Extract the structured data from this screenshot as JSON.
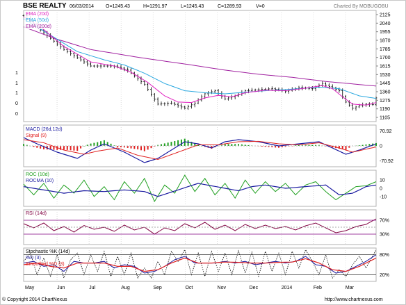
{
  "header": {
    "title": "BSE REALTY",
    "date": "06/03/2014",
    "open": "O=1245.43",
    "high": "H=1291.97",
    "low": "L=1245.43",
    "close": "C=1289.93",
    "volume": "V=0",
    "charted_by": "Charted By MOBUGOBU"
  },
  "footer": {
    "copyright": "© Copyright 2014 ChartNexus",
    "url": "http://www.chartnexus.com"
  },
  "colors": {
    "price": "#111111",
    "ema20": "#e020c0",
    "ema50": "#2aa8e0",
    "ema200": "#a020a0",
    "macd": "#1a1aa0",
    "signal": "#e02020",
    "hist_up": "#20a020",
    "hist_down": "#e02020",
    "roc": "#20a020",
    "rocma": "#1a1aa0",
    "rsi": "#800040",
    "stoch_k": "#000000",
    "stoch_d": "#1a1aa0",
    "stoch_sd": "#e02020",
    "frame": "#800080"
  },
  "chart_data": [
    {
      "type": "line",
      "panel": "price",
      "legend": [
        "EMA (20d)",
        "EMA (50d)",
        "EMA (200d)"
      ],
      "y_ticks_right": [
        "2125",
        "2040",
        "1955",
        "1870",
        "1785",
        "1700",
        "1615",
        "1530",
        "1445",
        "1360",
        "1275",
        "1190",
        "1105"
      ],
      "y_ticks_left": [
        "1",
        "1",
        "1",
        "0",
        "0"
      ],
      "ylim": [
        1060,
        2140
      ],
      "x_months": [
        "May",
        "Jun",
        "Jul",
        "Aug",
        "Sep",
        "Oct",
        "Nov",
        "Dec",
        "2014",
        "Feb",
        "Mar"
      ],
      "price_keypoints": [
        [
          0,
          2090
        ],
        [
          5,
          1950
        ],
        [
          12,
          1760
        ],
        [
          20,
          1600
        ],
        [
          27,
          1600
        ],
        [
          31,
          1560
        ],
        [
          36,
          1420
        ],
        [
          40,
          1230
        ],
        [
          44,
          1240
        ],
        [
          48,
          1190
        ],
        [
          51,
          1240
        ],
        [
          54,
          1330
        ],
        [
          57,
          1360
        ],
        [
          60,
          1280
        ],
        [
          63,
          1310
        ],
        [
          66,
          1360
        ],
        [
          70,
          1370
        ],
        [
          74,
          1380
        ],
        [
          78,
          1355
        ],
        [
          82,
          1390
        ],
        [
          86,
          1380
        ],
        [
          89,
          1430
        ],
        [
          91,
          1400
        ],
        [
          94,
          1360
        ],
        [
          96,
          1250
        ],
        [
          98,
          1190
        ],
        [
          100,
          1215
        ],
        [
          102,
          1230
        ],
        [
          104,
          1225
        ],
        [
          105,
          1290
        ]
      ],
      "ema20_keypoints": [
        [
          0,
          2080
        ],
        [
          5,
          1980
        ],
        [
          12,
          1790
        ],
        [
          20,
          1640
        ],
        [
          27,
          1600
        ],
        [
          32,
          1540
        ],
        [
          37,
          1440
        ],
        [
          42,
          1310
        ],
        [
          46,
          1250
        ],
        [
          50,
          1245
        ],
        [
          54,
          1290
        ],
        [
          58,
          1315
        ],
        [
          62,
          1300
        ],
        [
          66,
          1340
        ],
        [
          72,
          1365
        ],
        [
          78,
          1360
        ],
        [
          84,
          1385
        ],
        [
          89,
          1410
        ],
        [
          92,
          1380
        ],
        [
          95,
          1300
        ],
        [
          98,
          1230
        ],
        [
          102,
          1220
        ],
        [
          105,
          1245
        ]
      ],
      "ema50_keypoints": [
        [
          0,
          2060
        ],
        [
          8,
          1900
        ],
        [
          16,
          1740
        ],
        [
          24,
          1660
        ],
        [
          30,
          1610
        ],
        [
          36,
          1530
        ],
        [
          42,
          1430
        ],
        [
          48,
          1360
        ],
        [
          54,
          1340
        ],
        [
          60,
          1330
        ],
        [
          66,
          1345
        ],
        [
          72,
          1360
        ],
        [
          80,
          1375
        ],
        [
          88,
          1395
        ],
        [
          94,
          1380
        ],
        [
          100,
          1310
        ],
        [
          105,
          1285
        ]
      ],
      "ema200_keypoints": [
        [
          0,
          1980
        ],
        [
          10,
          1860
        ],
        [
          20,
          1760
        ],
        [
          35,
          1680
        ],
        [
          50,
          1610
        ],
        [
          60,
          1560
        ],
        [
          70,
          1520
        ],
        [
          80,
          1490
        ],
        [
          90,
          1450
        ],
        [
          100,
          1420
        ],
        [
          105,
          1405
        ]
      ]
    },
    {
      "type": "line",
      "panel": "macd",
      "legend": [
        "MACD (26d,12d)",
        "Signal (9)"
      ],
      "y_ticks": [
        "70.92",
        "0",
        "-70.92"
      ],
      "ylim": [
        -100,
        100
      ],
      "macd_keypoints": [
        [
          0,
          40
        ],
        [
          4,
          10
        ],
        [
          10,
          -30
        ],
        [
          16,
          -60
        ],
        [
          20,
          -20
        ],
        [
          24,
          10
        ],
        [
          30,
          -30
        ],
        [
          36,
          -80
        ],
        [
          40,
          -60
        ],
        [
          44,
          -20
        ],
        [
          48,
          20
        ],
        [
          52,
          10
        ],
        [
          56,
          -10
        ],
        [
          60,
          20
        ],
        [
          64,
          30
        ],
        [
          70,
          20
        ],
        [
          76,
          0
        ],
        [
          82,
          10
        ],
        [
          88,
          20
        ],
        [
          92,
          -10
        ],
        [
          96,
          -40
        ],
        [
          100,
          -20
        ],
        [
          105,
          10
        ]
      ],
      "signal_keypoints": [
        [
          0,
          30
        ],
        [
          6,
          15
        ],
        [
          12,
          -20
        ],
        [
          18,
          -40
        ],
        [
          22,
          -25
        ],
        [
          28,
          -10
        ],
        [
          34,
          -45
        ],
        [
          40,
          -65
        ],
        [
          46,
          -30
        ],
        [
          52,
          5
        ],
        [
          58,
          5
        ],
        [
          64,
          20
        ],
        [
          70,
          22
        ],
        [
          76,
          10
        ],
        [
          82,
          5
        ],
        [
          88,
          15
        ],
        [
          94,
          -10
        ],
        [
          98,
          -30
        ],
        [
          105,
          -5
        ]
      ]
    },
    {
      "type": "line",
      "panel": "roc",
      "legend": [
        "ROC (10d)",
        "ROCMA (10)"
      ],
      "y_ticks": [
        "10",
        "0",
        "-10"
      ],
      "ylim": [
        -22,
        22
      ],
      "roc_keypoints": [
        [
          0,
          5
        ],
        [
          3,
          -8
        ],
        [
          6,
          6
        ],
        [
          9,
          -12
        ],
        [
          12,
          4
        ],
        [
          15,
          -6
        ],
        [
          18,
          10
        ],
        [
          21,
          -10
        ],
        [
          24,
          2
        ],
        [
          27,
          -14
        ],
        [
          30,
          8
        ],
        [
          33,
          -6
        ],
        [
          36,
          12
        ],
        [
          39,
          -16
        ],
        [
          42,
          4
        ],
        [
          45,
          -6
        ],
        [
          48,
          16
        ],
        [
          51,
          -4
        ],
        [
          54,
          12
        ],
        [
          57,
          -8
        ],
        [
          60,
          6
        ],
        [
          63,
          -12
        ],
        [
          66,
          10
        ],
        [
          69,
          -6
        ],
        [
          72,
          8
        ],
        [
          75,
          -4
        ],
        [
          78,
          6
        ],
        [
          81,
          -8
        ],
        [
          84,
          4
        ],
        [
          87,
          8
        ],
        [
          90,
          -4
        ],
        [
          93,
          -14
        ],
        [
          96,
          -6
        ],
        [
          99,
          2
        ],
        [
          102,
          3
        ],
        [
          105,
          8
        ]
      ],
      "rocma_keypoints": [
        [
          0,
          2
        ],
        [
          6,
          -2
        ],
        [
          12,
          -6
        ],
        [
          18,
          -3
        ],
        [
          24,
          -4
        ],
        [
          30,
          -2
        ],
        [
          36,
          -4
        ],
        [
          40,
          -10
        ],
        [
          46,
          -2
        ],
        [
          52,
          6
        ],
        [
          56,
          3
        ],
        [
          60,
          0
        ],
        [
          64,
          -3
        ],
        [
          68,
          2
        ],
        [
          72,
          4
        ],
        [
          78,
          0
        ],
        [
          84,
          2
        ],
        [
          90,
          4
        ],
        [
          94,
          -8
        ],
        [
          98,
          -6
        ],
        [
          102,
          2
        ],
        [
          105,
          4
        ]
      ]
    },
    {
      "type": "line",
      "panel": "rsi",
      "legend": [
        "RSI (14d)"
      ],
      "y_ticks": [
        "70%",
        "30%"
      ],
      "ylim": [
        0,
        100
      ],
      "rsi_keypoints": [
        [
          0,
          60
        ],
        [
          3,
          48
        ],
        [
          6,
          62
        ],
        [
          9,
          40
        ],
        [
          12,
          52
        ],
        [
          15,
          36
        ],
        [
          18,
          55
        ],
        [
          21,
          44
        ],
        [
          24,
          50
        ],
        [
          27,
          38
        ],
        [
          30,
          56
        ],
        [
          33,
          42
        ],
        [
          36,
          50
        ],
        [
          39,
          30
        ],
        [
          42,
          48
        ],
        [
          45,
          40
        ],
        [
          48,
          60
        ],
        [
          51,
          48
        ],
        [
          54,
          64
        ],
        [
          57,
          44
        ],
        [
          60,
          56
        ],
        [
          63,
          40
        ],
        [
          66,
          58
        ],
        [
          69,
          46
        ],
        [
          72,
          56
        ],
        [
          75,
          46
        ],
        [
          78,
          52
        ],
        [
          81,
          42
        ],
        [
          84,
          54
        ],
        [
          87,
          62
        ],
        [
          90,
          48
        ],
        [
          93,
          34
        ],
        [
          96,
          40
        ],
        [
          99,
          52
        ],
        [
          102,
          58
        ],
        [
          105,
          74
        ]
      ]
    },
    {
      "type": "line",
      "panel": "stochastic",
      "legend": [
        "Stochastic %K (14d)",
        "%D (3)",
        "Smoothed %D (3)"
      ],
      "y_ticks": [
        "80%",
        "20%"
      ],
      "ylim": [
        0,
        100
      ],
      "k_keypoints": [
        [
          0,
          60
        ],
        [
          2,
          85
        ],
        [
          4,
          20
        ],
        [
          6,
          70
        ],
        [
          8,
          15
        ],
        [
          10,
          80
        ],
        [
          12,
          10
        ],
        [
          14,
          65
        ],
        [
          16,
          85
        ],
        [
          18,
          20
        ],
        [
          20,
          80
        ],
        [
          22,
          30
        ],
        [
          24,
          90
        ],
        [
          26,
          15
        ],
        [
          28,
          75
        ],
        [
          30,
          20
        ],
        [
          32,
          85
        ],
        [
          34,
          10
        ],
        [
          36,
          40
        ],
        [
          38,
          10
        ],
        [
          40,
          60
        ],
        [
          42,
          20
        ],
        [
          44,
          90
        ],
        [
          46,
          60
        ],
        [
          48,
          95
        ],
        [
          50,
          20
        ],
        [
          52,
          85
        ],
        [
          54,
          15
        ],
        [
          56,
          90
        ],
        [
          58,
          30
        ],
        [
          60,
          85
        ],
        [
          62,
          20
        ],
        [
          64,
          92
        ],
        [
          66,
          25
        ],
        [
          68,
          88
        ],
        [
          70,
          15
        ],
        [
          72,
          90
        ],
        [
          74,
          30
        ],
        [
          76,
          85
        ],
        [
          78,
          20
        ],
        [
          80,
          90
        ],
        [
          82,
          40
        ],
        [
          84,
          95
        ],
        [
          86,
          60
        ],
        [
          88,
          20
        ],
        [
          90,
          80
        ],
        [
          92,
          10
        ],
        [
          94,
          35
        ],
        [
          96,
          15
        ],
        [
          98,
          50
        ],
        [
          100,
          75
        ],
        [
          102,
          40
        ],
        [
          105,
          95
        ]
      ],
      "d_keypoints": [
        [
          0,
          55
        ],
        [
          3,
          60
        ],
        [
          6,
          45
        ],
        [
          9,
          50
        ],
        [
          12,
          30
        ],
        [
          15,
          60
        ],
        [
          18,
          55
        ],
        [
          21,
          55
        ],
        [
          24,
          60
        ],
        [
          27,
          40
        ],
        [
          30,
          50
        ],
        [
          33,
          45
        ],
        [
          36,
          25
        ],
        [
          39,
          30
        ],
        [
          42,
          45
        ],
        [
          45,
          65
        ],
        [
          48,
          75
        ],
        [
          51,
          55
        ],
        [
          54,
          55
        ],
        [
          57,
          55
        ],
        [
          60,
          60
        ],
        [
          63,
          55
        ],
        [
          66,
          60
        ],
        [
          69,
          50
        ],
        [
          72,
          55
        ],
        [
          75,
          60
        ],
        [
          78,
          55
        ],
        [
          81,
          60
        ],
        [
          84,
          75
        ],
        [
          87,
          50
        ],
        [
          90,
          45
        ],
        [
          93,
          25
        ],
        [
          96,
          30
        ],
        [
          99,
          45
        ],
        [
          102,
          60
        ],
        [
          105,
          80
        ]
      ],
      "sd_keypoints": [
        [
          0,
          50
        ],
        [
          4,
          55
        ],
        [
          8,
          45
        ],
        [
          12,
          40
        ],
        [
          16,
          55
        ],
        [
          20,
          55
        ],
        [
          24,
          55
        ],
        [
          28,
          45
        ],
        [
          32,
          45
        ],
        [
          36,
          30
        ],
        [
          40,
          35
        ],
        [
          44,
          55
        ],
        [
          48,
          70
        ],
        [
          52,
          55
        ],
        [
          56,
          55
        ],
        [
          60,
          58
        ],
        [
          64,
          57
        ],
        [
          68,
          55
        ],
        [
          72,
          55
        ],
        [
          76,
          57
        ],
        [
          80,
          58
        ],
        [
          84,
          68
        ],
        [
          88,
          55
        ],
        [
          92,
          35
        ],
        [
          96,
          30
        ],
        [
          100,
          45
        ],
        [
          105,
          70
        ]
      ]
    }
  ]
}
